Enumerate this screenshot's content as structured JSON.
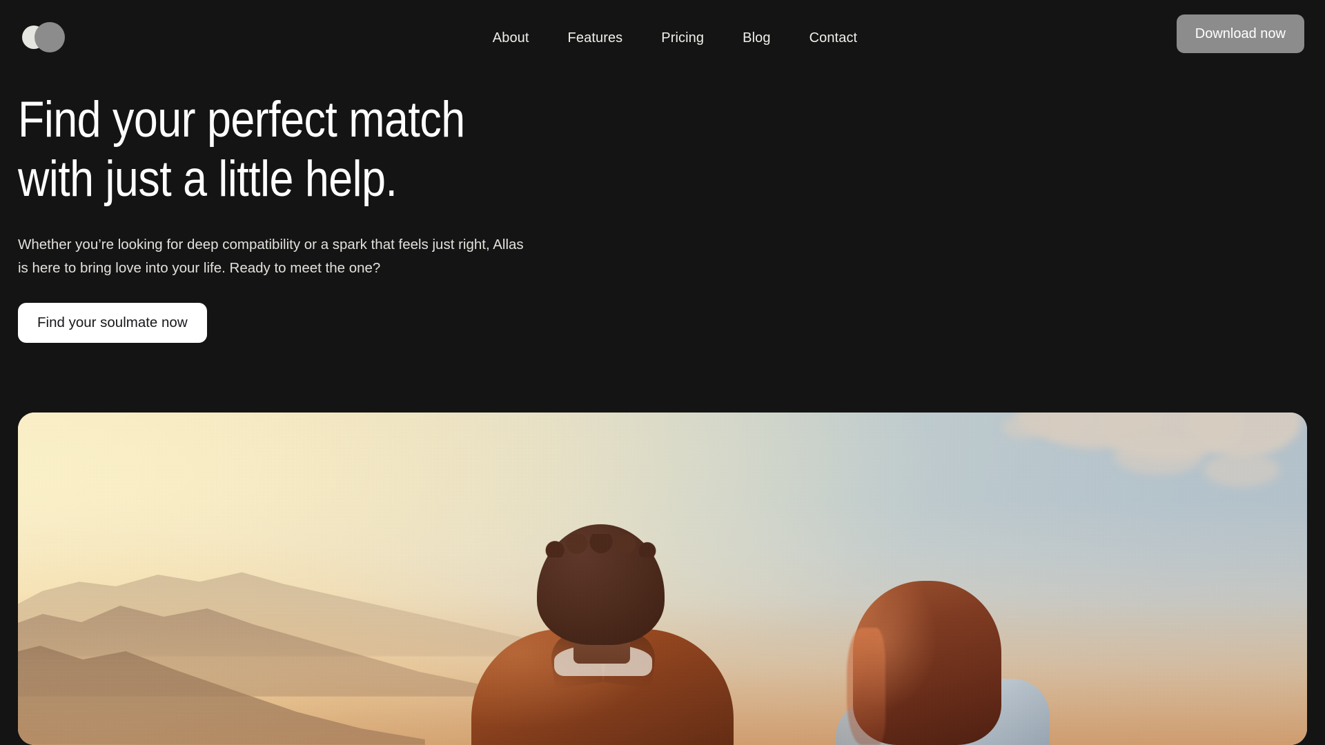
{
  "brand": {
    "name": "Allas",
    "logo_icon": "two-overlapping-circles-logo",
    "logo_light_color": "#e6e6e1",
    "logo_dark_color": "#8c8c8c"
  },
  "theme": {
    "background": "#141414",
    "text_primary": "#ffffff",
    "text_secondary": "#e3e1dc",
    "button_gray": "#8c8c8c",
    "button_white": "#ffffff",
    "button_white_text": "#17171a"
  },
  "header": {
    "nav": [
      {
        "label": "About"
      },
      {
        "label": "Features"
      },
      {
        "label": "Pricing"
      },
      {
        "label": "Blog"
      },
      {
        "label": "Contact"
      }
    ],
    "cta": {
      "label": "Download now"
    }
  },
  "hero": {
    "headline": "Find your perfect match\nwith just a little help.",
    "headline_line_1": "Find your perfect match",
    "headline_line_2": "with just a little help.",
    "subcopy": "Whether you’re looking for deep compatibility or a spark that feels just right, Allas is here to bring love into your life. Ready to meet the one?",
    "cta": {
      "label": "Find your soulmate now"
    },
    "image": {
      "alt": "Couple seen from behind watching a sunset over hazy mountains",
      "subjects": [
        {
          "name": "man",
          "description": "man with curly dark brown hair wearing a rust-orange jacket"
        },
        {
          "name": "woman",
          "description": "woman with long auburn hair wearing a light blue-gray top"
        }
      ],
      "scene": "sunset sky fading from warm cream on the left to blue-gray on the right, soft clouds top-right, hazy tan mountains on the left",
      "colors": {
        "sky_warm": "#f7eccd",
        "sky_cool": "#b2c0c9",
        "horizon_glow": "#e2a368",
        "mountain": "#8e7056",
        "jacket": "#93461f",
        "hair_woman": "#7e3b22",
        "top_woman": "#b4bfc8"
      },
      "corner_radius_px": 24
    }
  }
}
